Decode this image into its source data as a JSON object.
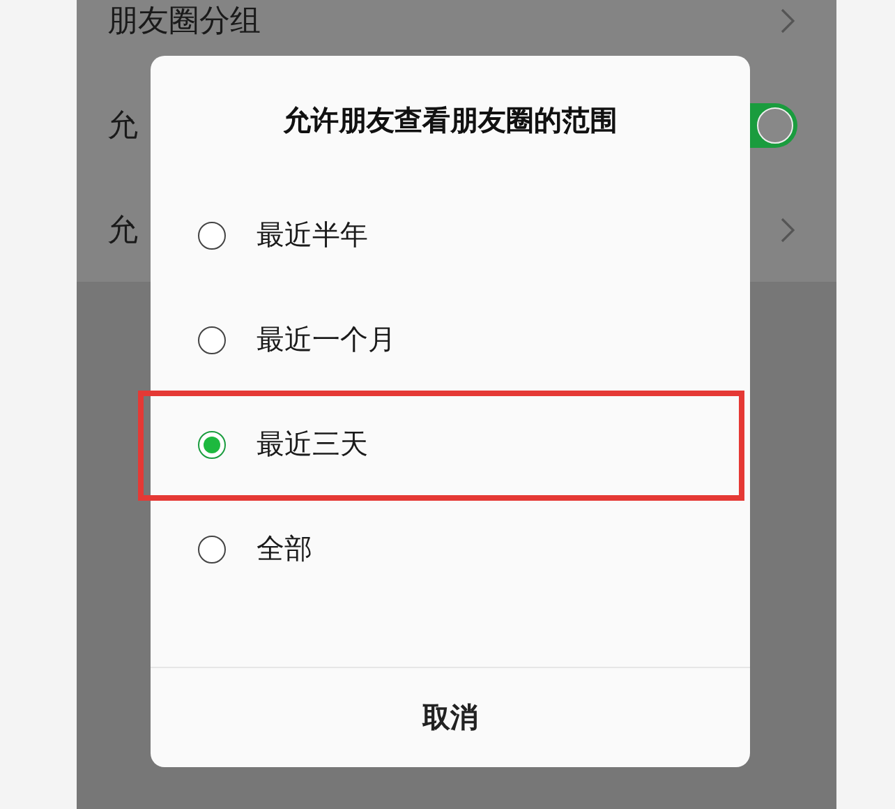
{
  "background_rows": [
    {
      "kind": "link",
      "label": "朋友圈分组"
    },
    {
      "kind": "toggle",
      "label": "允",
      "on": true
    },
    {
      "kind": "link",
      "label": "允"
    }
  ],
  "dialog": {
    "title": "允许朋友查看朋友圈的范围",
    "options": [
      {
        "label": "最近半年",
        "selected": false,
        "highlighted": false
      },
      {
        "label": "最近一个月",
        "selected": false,
        "highlighted": false
      },
      {
        "label": "最近三天",
        "selected": true,
        "highlighted": true
      },
      {
        "label": "全部",
        "selected": false,
        "highlighted": false
      }
    ],
    "cancel": "取消"
  }
}
